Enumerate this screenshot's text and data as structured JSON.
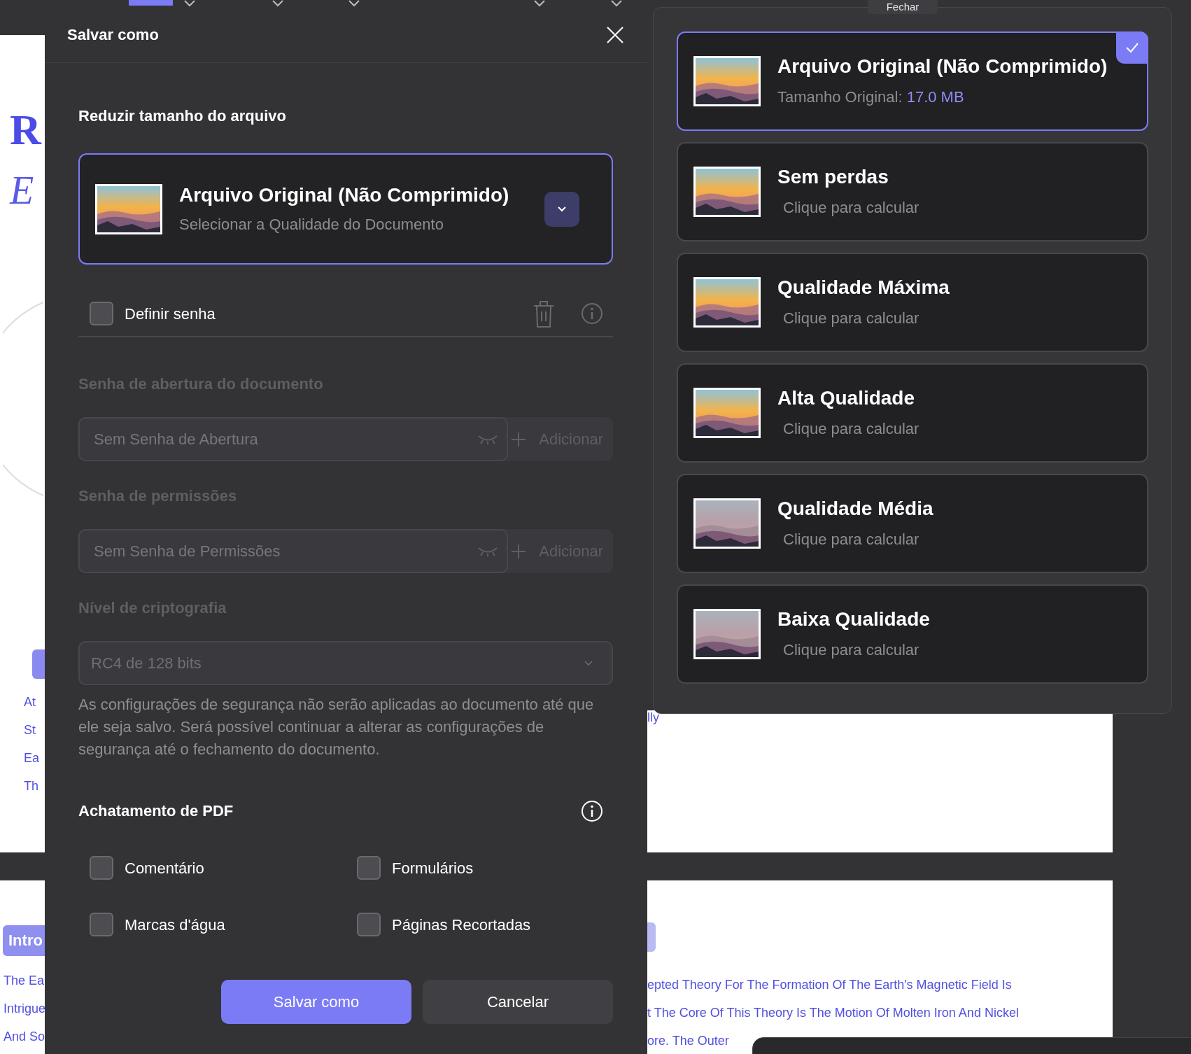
{
  "toolbar": {
    "close_tab": "Fechar"
  },
  "background_document": {
    "left_page": {
      "heading_letter": "R",
      "subtitle_letter": "E",
      "links": [
        "At",
        "St",
        "Ea",
        "Th"
      ]
    },
    "second_page_left": {
      "section_label": "Intro",
      "lines": [
        "The Ea",
        "Intrigue",
        "And So"
      ]
    },
    "right_page": {
      "fragment": "lly",
      "lines": [
        "epted Theory For The Formation Of The Earth's Magnetic Field Is",
        "t The Core Of This Theory Is The Motion Of Molten Iron And Nickel",
        "ore. The Outer"
      ]
    }
  },
  "dialog": {
    "title": "Salvar como",
    "reduce_size": {
      "heading": "Reduzir tamanho do arquivo",
      "quality_title": "Arquivo Original (Não Comprimido)",
      "quality_subtitle": "Selecionar a Qualidade do Documento"
    },
    "set_password": {
      "label": "Definir senha",
      "checked": false
    },
    "password_fields": [
      {
        "label": "Senha de abertura do documento",
        "placeholder": "Sem Senha de Abertura",
        "add_button": "Adicionar",
        "disabled": true
      },
      {
        "label": "Senha de permissões",
        "placeholder": "Sem Senha de Permissões",
        "add_button": "Adicionar",
        "disabled": true
      }
    ],
    "encryption": {
      "label": "Nível de criptografia",
      "value": "RC4 de 128 bits",
      "disabled": true
    },
    "note": "As configurações de segurança não serão aplicadas ao documento até que ele seja salvo. Será possível continuar a alterar as configurações de segurança até o fechamento do documento.",
    "flattening": {
      "heading": "Achatamento de PDF",
      "options": [
        {
          "label": "Comentário",
          "checked": false
        },
        {
          "label": "Formulários",
          "checked": false
        },
        {
          "label": "Marcas d'água",
          "checked": false
        },
        {
          "label": "Páginas Recortadas",
          "checked": false
        }
      ]
    },
    "buttons": [
      {
        "label": "Salvar como",
        "kind": "primary"
      },
      {
        "label": "Cancelar",
        "kind": "secondary"
      }
    ]
  },
  "quality_menu": [
    {
      "title": "Arquivo Original (Não Comprimido)",
      "detail": "Tamanho Original:",
      "size": "17.0 MB",
      "selected": true
    },
    {
      "title": "Sem perdas",
      "detail": "Clique para calcular",
      "selected": false
    },
    {
      "title": "Qualidade Máxima",
      "detail": "Clique para calcular",
      "selected": false
    },
    {
      "title": "Alta Qualidade",
      "detail": "Clique para calcular",
      "selected": false
    },
    {
      "title": "Qualidade Média",
      "detail": "Clique para calcular",
      "selected": false
    },
    {
      "title": "Baixa Qualidade",
      "detail": "Clique para calcular",
      "selected": false
    }
  ]
}
